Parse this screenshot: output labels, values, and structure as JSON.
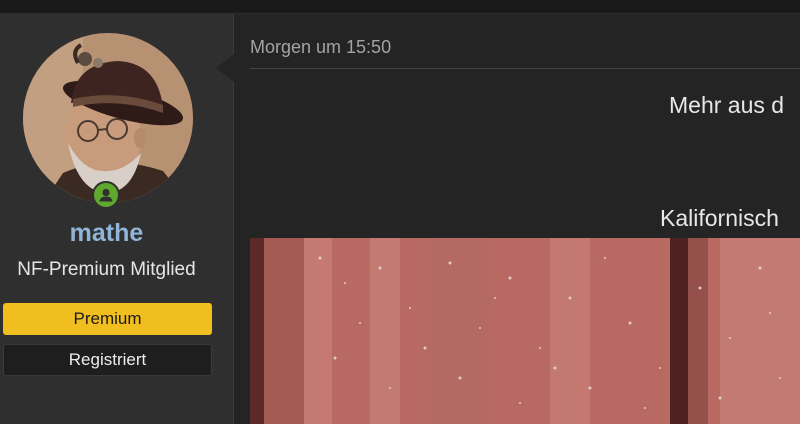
{
  "user": {
    "username": "mathe",
    "title": "NF-Premium Mitglied",
    "banners": [
      "Premium",
      "Registriert"
    ],
    "status_icon": "user-online-icon",
    "colors": {
      "username": "#8fb5d8",
      "premium_banner": "#f0be1f",
      "online": "#5ea82d"
    }
  },
  "post": {
    "timestamp": "Morgen um 15:50",
    "text_lines": [
      "Mehr aus d",
      "Kalifornisch"
    ]
  }
}
